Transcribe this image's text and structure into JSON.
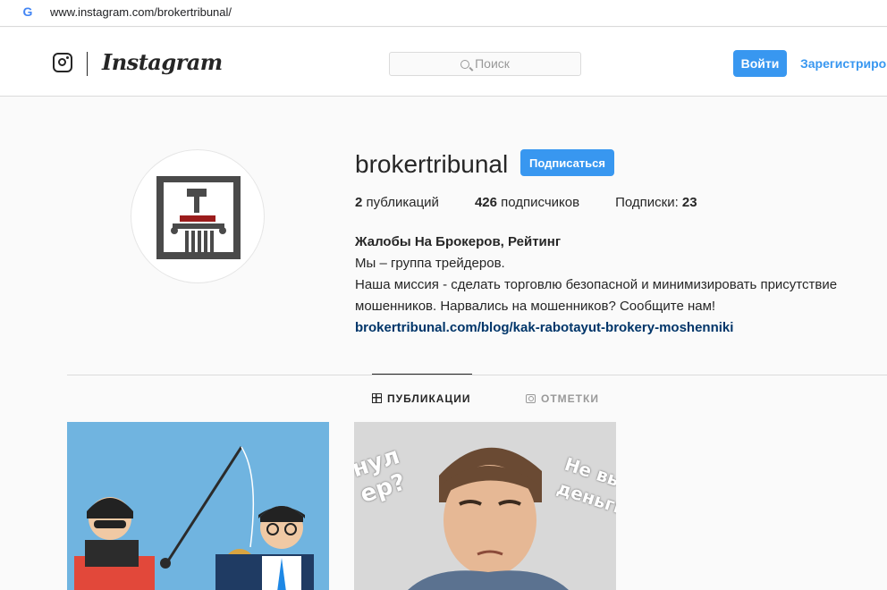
{
  "browser": {
    "url": "www.instagram.com/brokertribunal/",
    "g_icon": "google-g-icon"
  },
  "header": {
    "logo_text": "Instagram",
    "search_placeholder": "Поиск",
    "login_label": "Войти",
    "signup_label": "Зарегистрироваться"
  },
  "profile": {
    "username": "brokertribunal",
    "follow_label": "Подписаться",
    "posts_count": "2",
    "posts_label": " публикаций",
    "followers_count": "426",
    "followers_label": " подписчиков",
    "following_label": "Подписки: ",
    "following_count": "23",
    "bio_name": "Жалобы На Брокеров, Рейтинг",
    "bio_line1": "Мы – группа трейдеров.",
    "bio_line2": "Наша миссия - сделать торговлю безопасной и минимизировать присутствие мошенников. Нарвались на мошенников? Сообщите нам!",
    "bio_link": "brokertribunal.com/blog/kak-rabotayut-brokery-moshenniki"
  },
  "tabs": [
    {
      "label": "ПУБЛИКАЦИИ",
      "active": true
    },
    {
      "label": "ОТМЕТКИ",
      "active": false
    }
  ],
  "posts": [
    {
      "caption_left": ""
    },
    {
      "text_left": "нул\nер?",
      "text_right": "Не вы\nденьги"
    }
  ],
  "colors": {
    "accent": "#3897f0",
    "link": "#003569",
    "logo_red": "#9b1c1c",
    "logo_dark": "#4a4a4a"
  }
}
